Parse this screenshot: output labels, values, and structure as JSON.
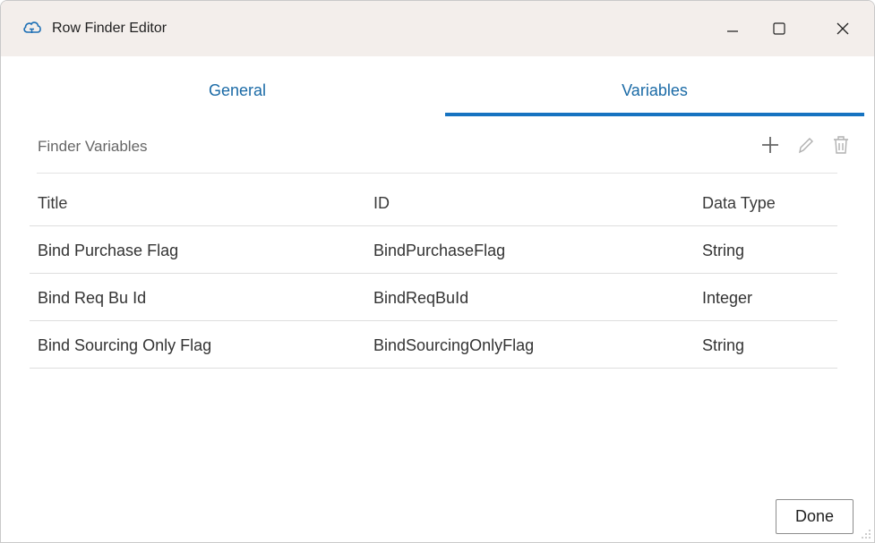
{
  "window": {
    "title": "Row Finder Editor",
    "icon": "cloud-icon",
    "controls": [
      "minimize-icon",
      "maximize-icon",
      "close-icon"
    ]
  },
  "tabs": [
    {
      "label": "General",
      "selected": false
    },
    {
      "label": "Variables",
      "selected": true
    }
  ],
  "section": {
    "title": "Finder Variables",
    "tools": [
      "add-icon",
      "edit-icon",
      "delete-icon"
    ]
  },
  "table": {
    "headers": {
      "title": "Title",
      "id": "ID",
      "type": "Data Type"
    },
    "rows": [
      {
        "title": "Bind Purchase Flag",
        "id": "BindPurchaseFlag",
        "type": "String"
      },
      {
        "title": "Bind Req Bu Id",
        "id": "BindReqBuId",
        "type": "Integer"
      },
      {
        "title": "Bind Sourcing Only Flag",
        "id": "BindSourcingOnlyFlag",
        "type": "String"
      }
    ]
  },
  "footer": {
    "done_label": "Done"
  },
  "colors": {
    "accent": "#1673c1",
    "tab_text": "#1a6aa6",
    "titlebar": "#f3eeeb"
  }
}
